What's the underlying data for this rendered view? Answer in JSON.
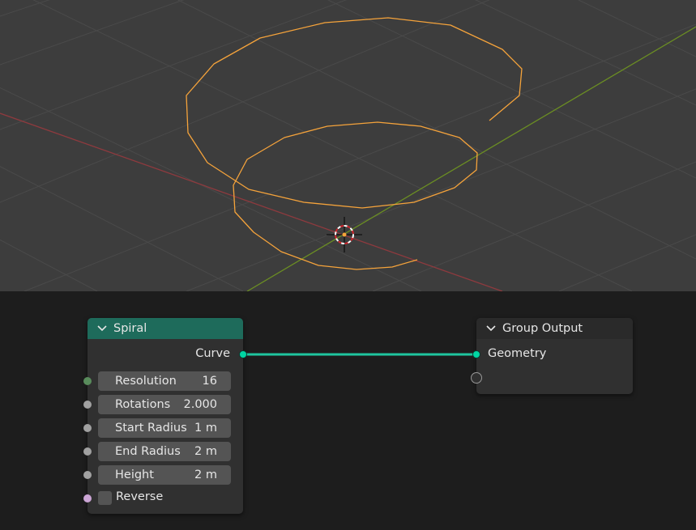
{
  "spiral_node": {
    "title": "Spiral",
    "output_label": "Curve",
    "inputs": [
      {
        "label": "Resolution",
        "value": "16"
      },
      {
        "label": "Rotations",
        "value": "2.000"
      },
      {
        "label": "Start Radius",
        "value": "1 m"
      },
      {
        "label": "End Radius",
        "value": "2 m"
      },
      {
        "label": "Height",
        "value": "2 m"
      }
    ],
    "reverse_label": "Reverse",
    "header_color": "#1e6b5b"
  },
  "group_output_node": {
    "title": "Group Output",
    "input_label": "Geometry",
    "header_color": "#2a2a2a"
  },
  "colors": {
    "geometry_socket": "#00d6a3",
    "int_socket": "#598c5c",
    "float_socket": "#a1a1a1",
    "bool_socket": "#cca6d6",
    "curve_wire": "#f5a33b",
    "x_axis": "#8e3a3e",
    "y_axis": "#6b8e23"
  }
}
